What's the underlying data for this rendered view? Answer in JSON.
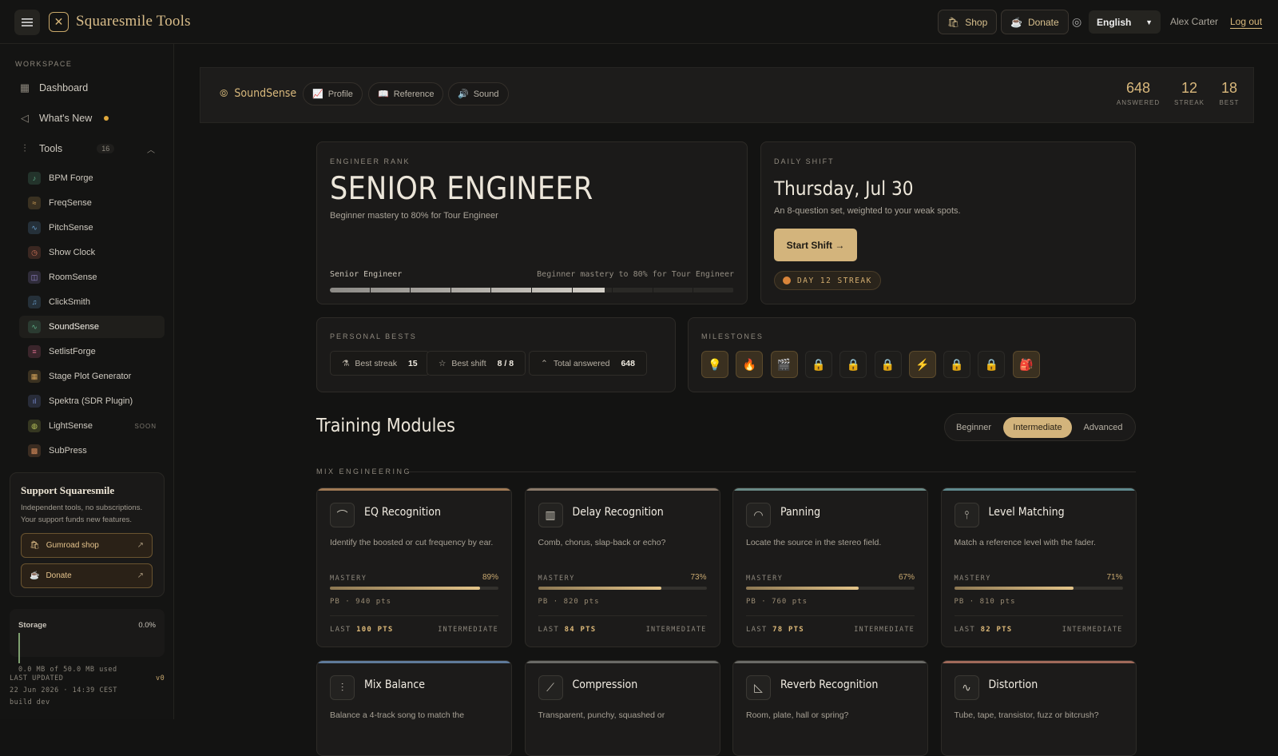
{
  "app": {
    "brand": "Squaresmile Tools"
  },
  "topbar": {
    "shop": "Shop",
    "donate": "Donate",
    "language": "English",
    "user": "Alex Carter",
    "logout": "Log out"
  },
  "sidebar": {
    "workspace": "WORKSPACE",
    "dashboard": "Dashboard",
    "whats_new": "What's New",
    "tools_label": "Tools",
    "tools_count": "16",
    "tools": [
      {
        "label": "BPM Forge",
        "color": "#5fb08a"
      },
      {
        "label": "FreqSense",
        "color": "#d4a35a"
      },
      {
        "label": "PitchSense",
        "color": "#6aa0d0"
      },
      {
        "label": "Show Clock",
        "color": "#d4755a"
      },
      {
        "label": "RoomSense",
        "color": "#9a8cd4"
      },
      {
        "label": "ClickSmith",
        "color": "#6aa0d0"
      },
      {
        "label": "SoundSense",
        "color": "#5fb08a"
      },
      {
        "label": "SetlistForge",
        "color": "#d46a8a"
      },
      {
        "label": "Stage Plot Generator",
        "color": "#d4a35a"
      },
      {
        "label": "Spektra (SDR Plugin)",
        "color": "#7a8cd4"
      },
      {
        "label": "LightSense",
        "color": "#b8c25a",
        "badge": "SOON"
      },
      {
        "label": "SubPress",
        "color": "#d48a5a"
      }
    ],
    "support": {
      "title": "Support Squaresmile",
      "text": "Independent tools, no subscriptions. Your support funds new features.",
      "shop": "Gumroad shop",
      "donate": "Donate"
    },
    "storage": {
      "label": "Storage",
      "pct": "0.0%",
      "used": "0.0 MB of 50.0 MB used"
    },
    "footer": {
      "updated_label": "LAST UPDATED",
      "version": "v0",
      "updated": "22 Jun 2026 · 14:39 CEST",
      "build": "build dev"
    }
  },
  "header": {
    "title": "SoundSense",
    "tabs": [
      "Profile",
      "Reference",
      "Sound"
    ],
    "stats": [
      {
        "value": "648",
        "label": "ANSWERED"
      },
      {
        "value": "12",
        "label": "STREAK"
      },
      {
        "value": "18",
        "label": "BEST"
      }
    ]
  },
  "rank": {
    "label": "ENGINEER RANK",
    "title": "SENIOR ENGINEER",
    "subtitle": "Beginner mastery to 80% for Tour Engineer",
    "progress_label": "Senior Engineer",
    "progress_hint": "Beginner mastery to 80% for Tour Engineer",
    "progress": 0.68
  },
  "daily": {
    "label": "DAILY SHIFT",
    "date": "Thursday, Jul 30",
    "desc": "An 8-question set, weighted to your weak spots.",
    "button": "Start Shift →",
    "streak": "DAY 12 STREAK"
  },
  "bests": {
    "label": "PERSONAL BESTS",
    "items": [
      {
        "label": "Best streak",
        "value": "15"
      },
      {
        "label": "Best shift",
        "value": "8 / 8"
      },
      {
        "label": "Total answered",
        "value": "648"
      }
    ]
  },
  "milestones": {
    "label": "MILESTONES",
    "items": [
      {
        "icon": "💡",
        "unlocked": true
      },
      {
        "icon": "🔥",
        "unlocked": true
      },
      {
        "icon": "🎬",
        "unlocked": true
      },
      {
        "icon": "🔒",
        "unlocked": false
      },
      {
        "icon": "🔒",
        "unlocked": false
      },
      {
        "icon": "🔒",
        "unlocked": false
      },
      {
        "icon": "⚡",
        "unlocked": true
      },
      {
        "icon": "🔒",
        "unlocked": false
      },
      {
        "icon": "🔒",
        "unlocked": false
      },
      {
        "icon": "🎒",
        "unlocked": true
      }
    ]
  },
  "training": {
    "title": "Training Modules",
    "levels": [
      "Beginner",
      "Intermediate",
      "Advanced"
    ],
    "active_level": "Intermediate",
    "section": "MIX ENGINEERING"
  },
  "modules": [
    {
      "title": "EQ Recognition",
      "desc": "Identify the boosted or cut frequency by ear.",
      "mastery_label": "MASTERY",
      "mastery": "89%",
      "mastery_value": 0.89,
      "pb": "PB · 940 pts",
      "last_label": "LAST",
      "last": "100 PTS",
      "level": "INTERMEDIATE",
      "icon": "⌒",
      "accent": "#a07a55"
    },
    {
      "title": "Delay Recognition",
      "desc": "Comb, chorus, slap-back or echo?",
      "mastery_label": "MASTERY",
      "mastery": "73%",
      "mastery_value": 0.73,
      "pb": "PB · 820 pts",
      "last_label": "LAST",
      "last": "84 PTS",
      "level": "INTERMEDIATE",
      "icon": "▥",
      "accent": "#8a7a6a"
    },
    {
      "title": "Panning",
      "desc": "Locate the source in the stereo field.",
      "mastery_label": "MASTERY",
      "mastery": "67%",
      "mastery_value": 0.67,
      "pb": "PB · 760 pts",
      "last_label": "LAST",
      "last": "78 PTS",
      "level": "INTERMEDIATE",
      "icon": "◠",
      "accent": "#6a8a86"
    },
    {
      "title": "Level Matching",
      "desc": "Match a reference level with the fader.",
      "mastery_label": "MASTERY",
      "mastery": "71%",
      "mastery_value": 0.71,
      "pb": "PB · 810 pts",
      "last_label": "LAST",
      "last": "82 PTS",
      "level": "INTERMEDIATE",
      "icon": "⫯",
      "accent": "#5f8a8e"
    },
    {
      "title": "Mix Balance",
      "desc": "Balance a 4-track song to match the",
      "icon": "⫶",
      "accent": "#5f7a9a"
    },
    {
      "title": "Compression",
      "desc": "Transparent, punchy, squashed or",
      "icon": "⟋",
      "accent": "#6a6a66"
    },
    {
      "title": "Reverb Recognition",
      "desc": "Room, plate, hall or spring?",
      "icon": "◺",
      "accent": "#6a6a66"
    },
    {
      "title": "Distortion",
      "desc": "Tube, tape, transistor, fuzz or bitcrush?",
      "icon": "∿",
      "accent": "#a06a5a"
    }
  ]
}
